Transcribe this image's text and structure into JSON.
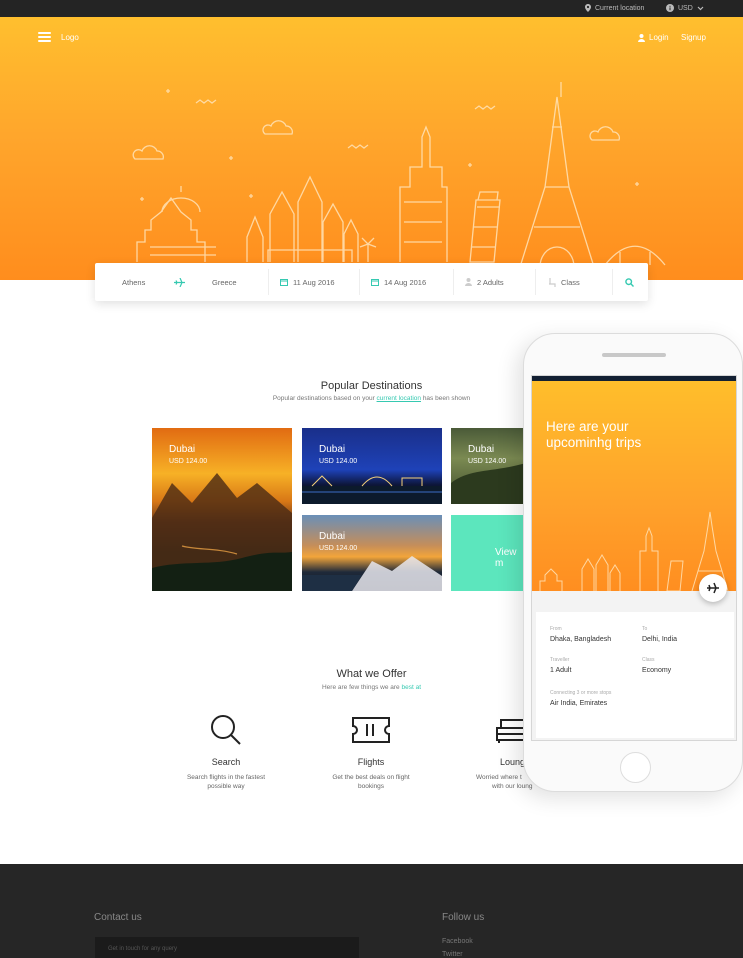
{
  "topbar": {
    "location": "Current location",
    "currency": "USD"
  },
  "header": {
    "logo": "Logo",
    "login": "Login",
    "signup": "Signup"
  },
  "search": {
    "from": "Athens",
    "to": "Greece",
    "depart": "11 Aug 2016",
    "return": "14 Aug 2016",
    "travellers": "2 Adults",
    "class": "Class"
  },
  "popular": {
    "title": "Popular Destinations",
    "subtitle_pre": "Popular destinations based on your",
    "subtitle_link": "current location",
    "subtitle_post": "has been shown",
    "cards": [
      {
        "city": "Dubai",
        "price": "USD 124.00"
      },
      {
        "city": "Dubai",
        "price": "USD 124.00"
      },
      {
        "city": "Dubai",
        "price": "USD 124.00"
      },
      {
        "city": "Dubai",
        "price": "USD 124.00"
      }
    ],
    "view_more": "View m"
  },
  "offer": {
    "title": "What we Offer",
    "subtitle_pre": "Here are few things we are",
    "subtitle_link": "best at",
    "items": [
      {
        "title": "Search",
        "desc_line1": "Search flights in the fastest",
        "desc_line2": "possible way",
        "icon": "search-icon"
      },
      {
        "title": "Flights",
        "desc_line1": "Get the best deals on flight",
        "desc_line2": "bookings",
        "icon": "ticket-icon"
      },
      {
        "title": "Loung",
        "desc_line1": "Worried where t",
        "desc_line2": "with our loung",
        "icon": "sofa-icon"
      }
    ]
  },
  "footer": {
    "contact_title": "Contact us",
    "contact_placeholder": "Get in touch for any query",
    "follow_title": "Follow us",
    "links": [
      "Facebook",
      "Twitter"
    ]
  },
  "phone": {
    "title": "Here are your upcominhg trips",
    "from_label": "From",
    "from_value": "Dhaka, Bangladesh",
    "to_label": "To",
    "to_value": "Delhi, India",
    "traveller_label": "Traveller",
    "traveller_value": "1 Adult",
    "class_label": "Class",
    "class_value": "Economy",
    "connecting_label": "Connecting 3 or more stops",
    "connecting_value": "Air India, Emirates"
  },
  "colors": {
    "accent": "#36c9b1",
    "hero_top": "#ffbf2e",
    "hero_bottom": "#ff8d1d",
    "viewmore": "#5ce6bd",
    "footer": "#262626"
  }
}
